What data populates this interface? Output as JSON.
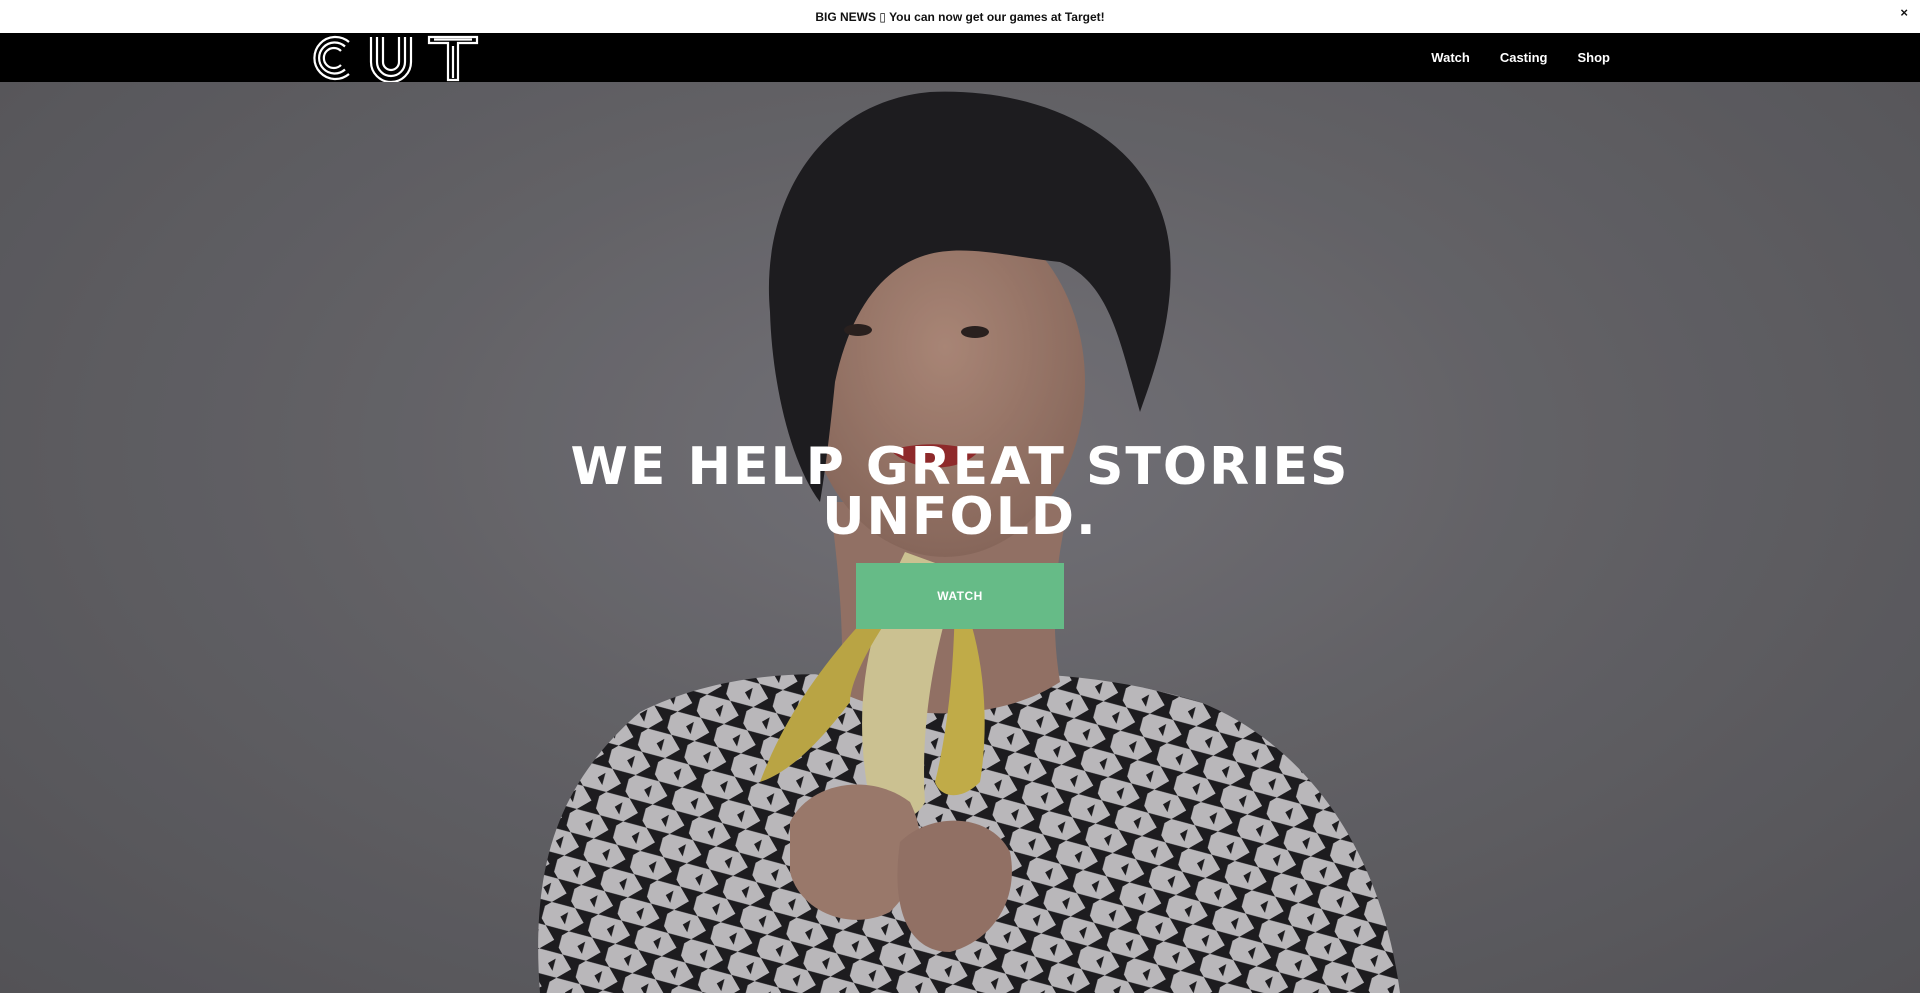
{
  "announcement": {
    "text": "BIG NEWS ▯ You can now get our games at Target!",
    "close_label": "×"
  },
  "header": {
    "logo_text": "CUT",
    "nav": [
      {
        "label": "Watch"
      },
      {
        "label": "Casting"
      },
      {
        "label": "Shop"
      }
    ]
  },
  "hero": {
    "title_line1": "WE HELP GREAT STORIES",
    "title_line2": "UNFOLD.",
    "cta_label": "WATCH"
  },
  "colors": {
    "cta": "#66bb87",
    "header_bg": "#000000",
    "hero_bg": "#6b6a6e"
  }
}
